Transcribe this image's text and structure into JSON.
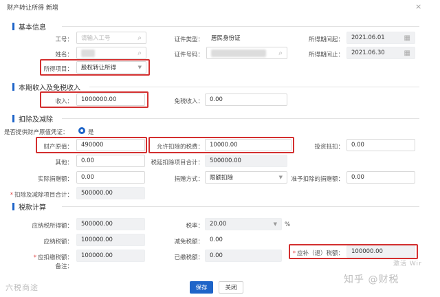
{
  "dialog": {
    "title": "财产转让所得 新增",
    "close_icon": "×"
  },
  "sections": {
    "basic": "基本信息",
    "income": "本期收入及免税收入",
    "deduction": "扣除及减除",
    "tax": "税款计算"
  },
  "basic": {
    "employee_id": {
      "label": "工号：",
      "placeholder": "请输入工号"
    },
    "name": {
      "label": "姓名："
    },
    "id_type": {
      "label": "证件类型：",
      "value": "居民身份证"
    },
    "id_number": {
      "label": "证件号码："
    },
    "period_start": {
      "label": "所得期间起：",
      "value": "2021.06.01"
    },
    "period_end": {
      "label": "所得期间止：",
      "value": "2021.06.30"
    },
    "income_item": {
      "label": "所得项目：",
      "value": "股权转让所得"
    }
  },
  "income": {
    "income": {
      "label": "收入：",
      "value": "1000000.00"
    },
    "tax_free": {
      "label": "免税收入：",
      "value": "0.00"
    }
  },
  "deduction": {
    "proof": {
      "label": "是否提供财产原值凭证：",
      "option": "是"
    },
    "original_value": {
      "label": "财产原值：",
      "value": "490000"
    },
    "allowed_tax": {
      "label": "允许扣除的税费：",
      "value": "10000.00"
    },
    "investment_offset": {
      "label": "投资抵扣：",
      "value": "0.00"
    },
    "other": {
      "label": "其他：",
      "value": "0.00"
    },
    "deferred_total": {
      "label": "税延扣除项目合计：",
      "value": "500000.00"
    },
    "actual_donation": {
      "label": "实际捐赠额：",
      "value": "0.00"
    },
    "donation_method": {
      "label": "捐赠方式：",
      "value": "限额扣除"
    },
    "allowed_donation": {
      "label": "准予扣除的捐赠额：",
      "value": "0.00"
    },
    "deduction_total": {
      "label": "扣除及减除项目合计：",
      "value": "500000.00"
    }
  },
  "tax": {
    "taxable_income": {
      "label": "应纳税所得额：",
      "value": "500000.00"
    },
    "rate": {
      "label": "税率：",
      "value": "20.00",
      "unit": "%"
    },
    "tax_payable": {
      "label": "应纳税额：",
      "value": "100000.00"
    },
    "tax_reduction": {
      "label": "减免税额：",
      "value": "0.00"
    },
    "tax_withheld": {
      "label": "应扣缴税额：",
      "value": "100000.00"
    },
    "tax_paid": {
      "label": "已缴税额：",
      "value": "0.00"
    },
    "tax_due": {
      "label": "应补（退）税额：",
      "value": "100000.00"
    },
    "remark": {
      "label": "备注："
    }
  },
  "buttons": {
    "save": "保存",
    "close": "关闭"
  },
  "watermarks": {
    "left": "六税商途",
    "right": "知乎 @财税",
    "windows": "激活 Wir"
  }
}
